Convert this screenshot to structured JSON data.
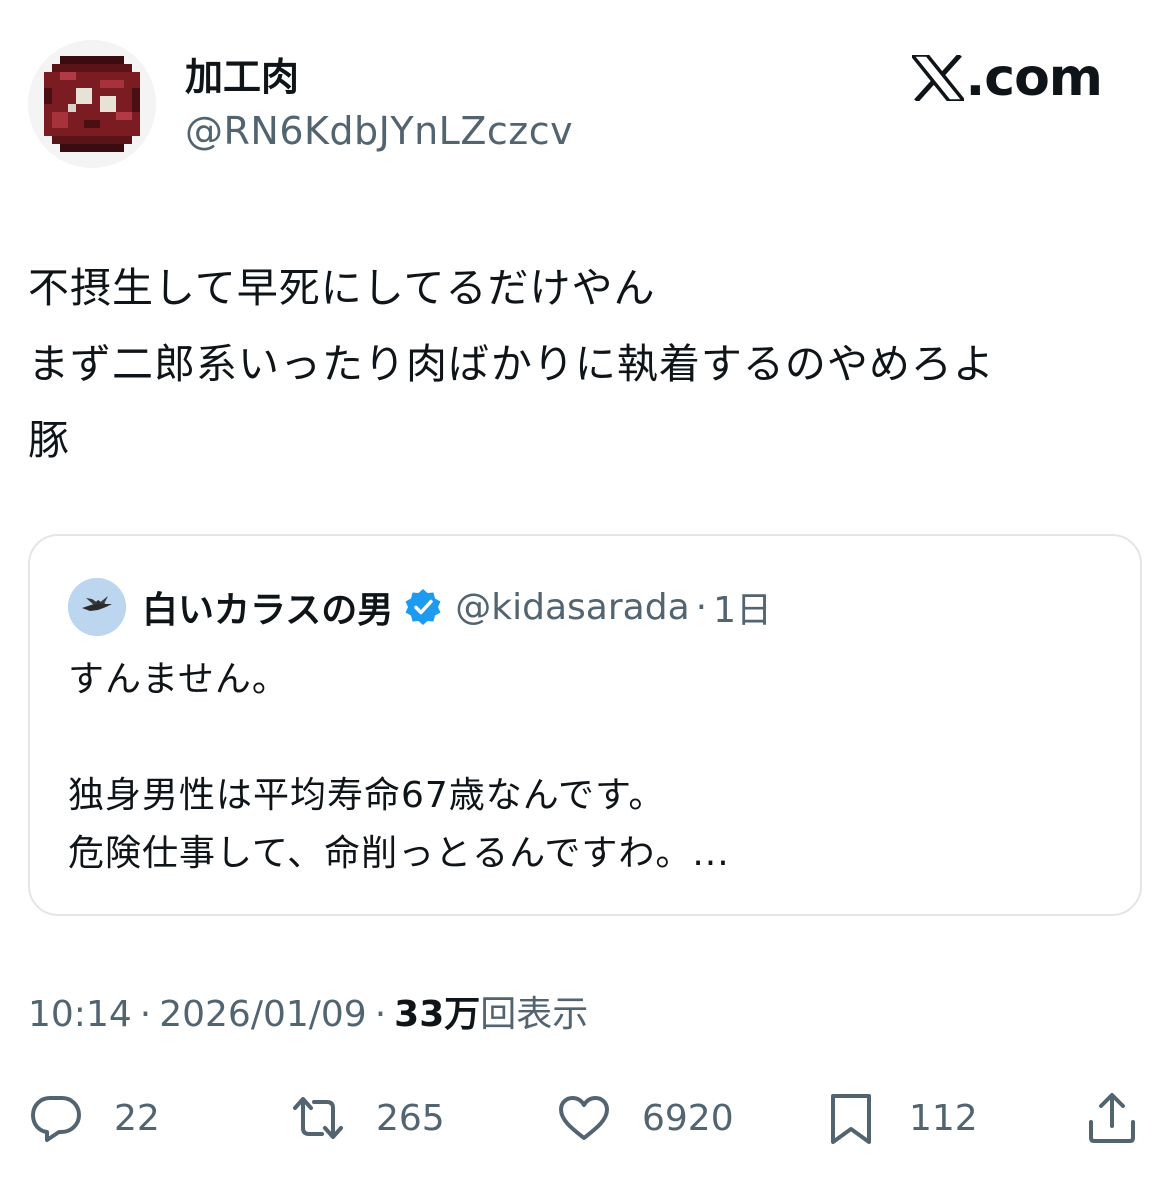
{
  "author": {
    "display_name": "加工肉",
    "handle": "@RN6KdbJYnLZczcv",
    "avatar_icon": "pixel-meat-avatar"
  },
  "brand": {
    "icon": "x-logo-icon",
    "text": ".com"
  },
  "tweet": {
    "lines": [
      "不摂生して早死にしてるだけやん",
      "まず二郎系いったり肉ばかりに執着するのやめろよ",
      "豚"
    ]
  },
  "quoted_tweet": {
    "avatar_icon": "crow-avatar",
    "display_name": "白いカラスの男",
    "verified_icon": "verified-badge-icon",
    "handle": "@kidasarada",
    "separator": "·",
    "time": "1日",
    "lines": [
      "すんません。",
      "",
      "独身男性は平均寿命67歳なんです。",
      "危険仕事して、命削っとるんですわ。..."
    ]
  },
  "meta": {
    "time": "10:14",
    "separator": "·",
    "date": "2026/01/09",
    "views_count": "33万",
    "views_label": "回表示"
  },
  "actions": {
    "reply": {
      "icon": "reply-icon",
      "count": "22"
    },
    "repost": {
      "icon": "repost-icon",
      "count": "265"
    },
    "like": {
      "icon": "heart-icon",
      "count": "6920"
    },
    "bookmark": {
      "icon": "bookmark-icon",
      "count": "112"
    },
    "share": {
      "icon": "share-icon"
    }
  },
  "colors": {
    "text": "#0f1419",
    "secondary": "#536471",
    "border": "#e3e6e9",
    "verified": "#1d9bf0"
  }
}
